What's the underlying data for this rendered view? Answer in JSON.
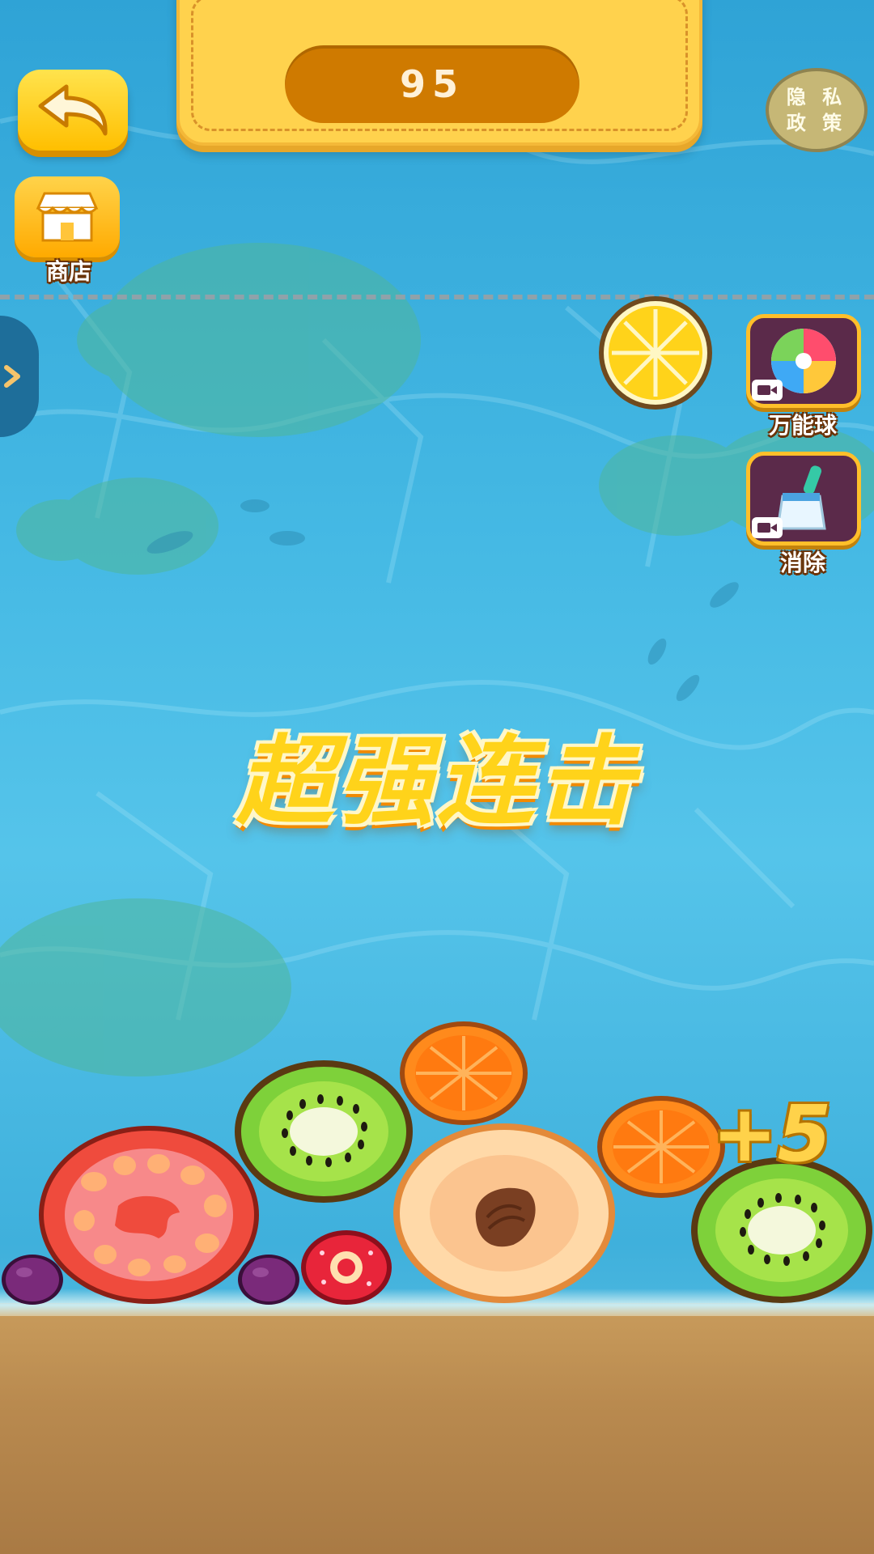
{
  "score": {
    "value": "95"
  },
  "privacy": {
    "line1": "隐 私",
    "line2": "政 策"
  },
  "shop": {
    "label": "商店"
  },
  "powerups": {
    "omni_ball_label": "万能球",
    "clear_label": "消除"
  },
  "combo": {
    "text": "超强连击"
  },
  "plus_score": {
    "text": "+5"
  },
  "fruits": {
    "next": "lemon",
    "stack": [
      "grape",
      "tomato",
      "grape",
      "cherry",
      "kiwi",
      "peach",
      "orange",
      "orange",
      "kiwi"
    ]
  },
  "colors": {
    "score_panel": "#ffd24d",
    "score_pill": "#cf7a00",
    "combo_text": "#ffd31a",
    "water": "#45b9e4",
    "sand": "#b98a4f"
  },
  "icons": {
    "back": "back-arrow-icon",
    "shop": "storefront-icon",
    "omni_ball": "beach-ball-icon",
    "clear": "brush-icon",
    "video": "video-ad-icon"
  }
}
